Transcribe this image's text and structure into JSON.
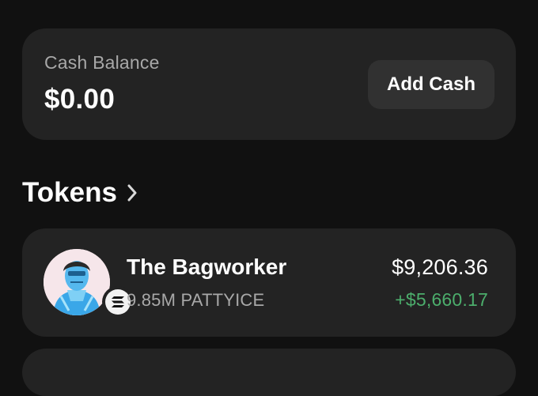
{
  "cash": {
    "label": "Cash Balance",
    "value": "$0.00",
    "add_button_label": "Add Cash"
  },
  "tokens_section": {
    "title": "Tokens",
    "chevron_icon": "chevron-right-icon"
  },
  "tokens": [
    {
      "name": "The Bagworker",
      "amount": "9.85M PATTYICE",
      "value": "$9,206.36",
      "change": "+$5,660.17",
      "change_color": "#4cae6c",
      "chain_icon": "solana-icon"
    }
  ]
}
